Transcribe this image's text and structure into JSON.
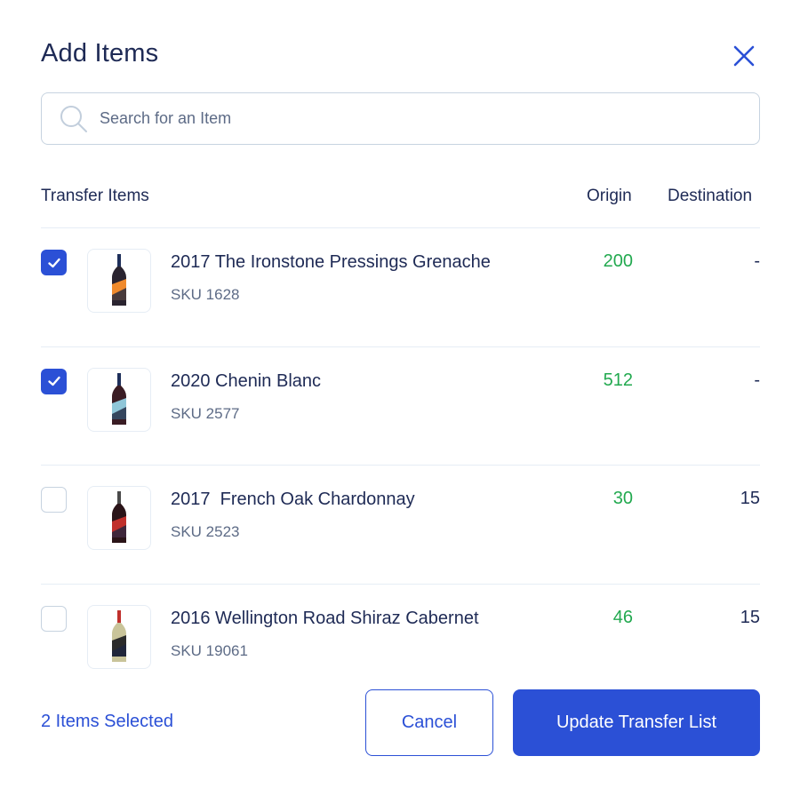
{
  "dialog": {
    "title": "Add Items",
    "close_icon": "close-x-icon"
  },
  "search": {
    "placeholder": "Search for an Item",
    "value": "",
    "icon": "search-icon"
  },
  "columns": {
    "items": "Transfer Items",
    "origin": "Origin",
    "destination": "Destination"
  },
  "items": [
    {
      "name": "2017 The Ironstone Pressings Grenache",
      "sku": "SKU 1628",
      "origin": "200",
      "destination": "-",
      "checked": true,
      "label_color": "#f08a2c",
      "bottle_color": "#2a2430",
      "capsule_color": "#1e2f5a"
    },
    {
      "name": "2020 Chenin Blanc",
      "sku": "SKU 2577",
      "origin": "512",
      "destination": "-",
      "checked": true,
      "label_color": "#8fc6d8",
      "bottle_color": "#3a1c24",
      "capsule_color": "#1e2f5a"
    },
    {
      "name": "2017  French Oak Chardonnay",
      "sku": "SKU 2523",
      "origin": "30",
      "destination": "15",
      "checked": false,
      "label_color": "#c0302c",
      "bottle_color": "#2a1418",
      "capsule_color": "#4a4a4a"
    },
    {
      "name": "2016 Wellington Road Shiraz Cabernet",
      "sku": "SKU 19061",
      "origin": "46",
      "destination": "15",
      "checked": false,
      "label_color": "#2b2b2b",
      "bottle_color": "#c9c49a",
      "capsule_color": "#c0302c"
    }
  ],
  "footer": {
    "selected_label": "2 Items Selected",
    "cancel_label": "Cancel",
    "update_label": "Update Transfer List"
  },
  "colors": {
    "accent": "#2b50d6",
    "positive": "#22a94f",
    "text": "#1e2a55",
    "muted": "#5d6b86",
    "border": "#c7d3e0"
  }
}
